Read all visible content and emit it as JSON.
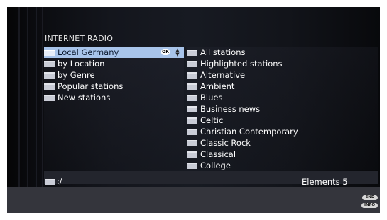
{
  "screen": {
    "title": "INTERNET RADIO"
  },
  "left_list": {
    "items": [
      {
        "label": "Local Germany",
        "selected": true
      },
      {
        "label": "by Location"
      },
      {
        "label": "by Genre"
      },
      {
        "label": "Popular stations"
      },
      {
        "label": "New stations"
      }
    ],
    "ok_label": "OK",
    "arrows_icon": "up-down-arrows-icon"
  },
  "right_list": {
    "items": [
      {
        "label": "All stations"
      },
      {
        "label": "Highlighted stations"
      },
      {
        "label": "Alternative"
      },
      {
        "label": "Ambient"
      },
      {
        "label": "Blues"
      },
      {
        "label": "Business news"
      },
      {
        "label": "Celtic"
      },
      {
        "label": "Christian Contemporary"
      },
      {
        "label": "Classic Rock"
      },
      {
        "label": "Classical"
      },
      {
        "label": "College"
      }
    ]
  },
  "status": {
    "path": ":/",
    "elements": "Elements 5"
  },
  "buttons": {
    "end_label": "END",
    "info_label": "INFO"
  }
}
